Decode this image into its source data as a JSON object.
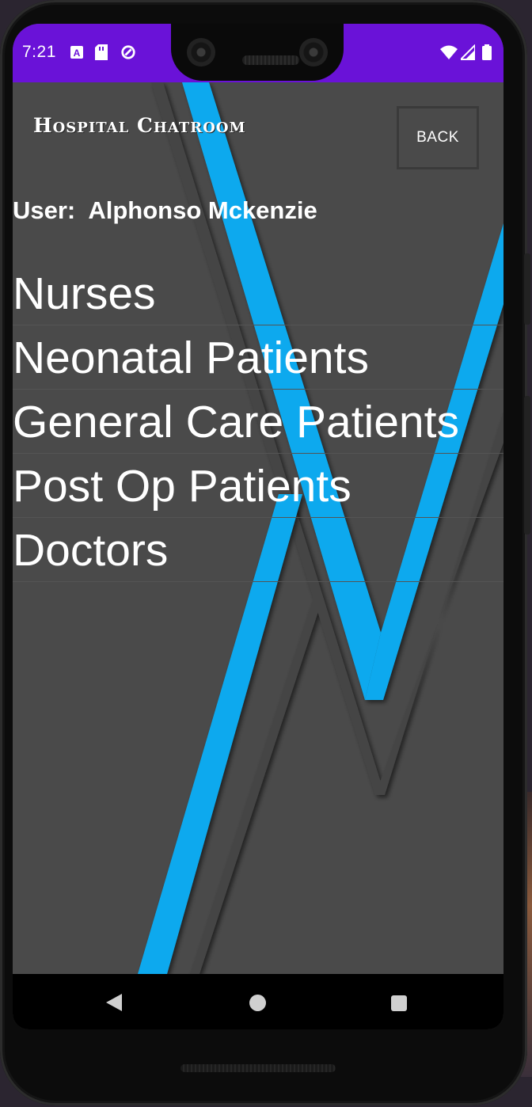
{
  "status_bar": {
    "time": "7:21",
    "left_icons": [
      "a-icon",
      "sd-card-icon",
      "sync-icon"
    ],
    "right_icons": [
      "wifi-icon",
      "signal-icon",
      "battery-icon"
    ],
    "color": "#6a12d8"
  },
  "app_bar": {
    "title": "Hospital Chatroom",
    "back_label": "BACK"
  },
  "user": {
    "label": "User:",
    "name": "Alphonso Mckenzie"
  },
  "chat_rooms": [
    {
      "label": "Nurses"
    },
    {
      "label": "Neonatal Patients"
    },
    {
      "label": "General Care Patients"
    },
    {
      "label": "Post Op Patients"
    },
    {
      "label": "Doctors"
    }
  ],
  "nav_bar": {
    "buttons": [
      "back-icon",
      "home-icon",
      "recents-icon"
    ]
  },
  "colors": {
    "background": "#4a4a4a",
    "accent": "#0aa9ee",
    "text": "#ffffff"
  }
}
